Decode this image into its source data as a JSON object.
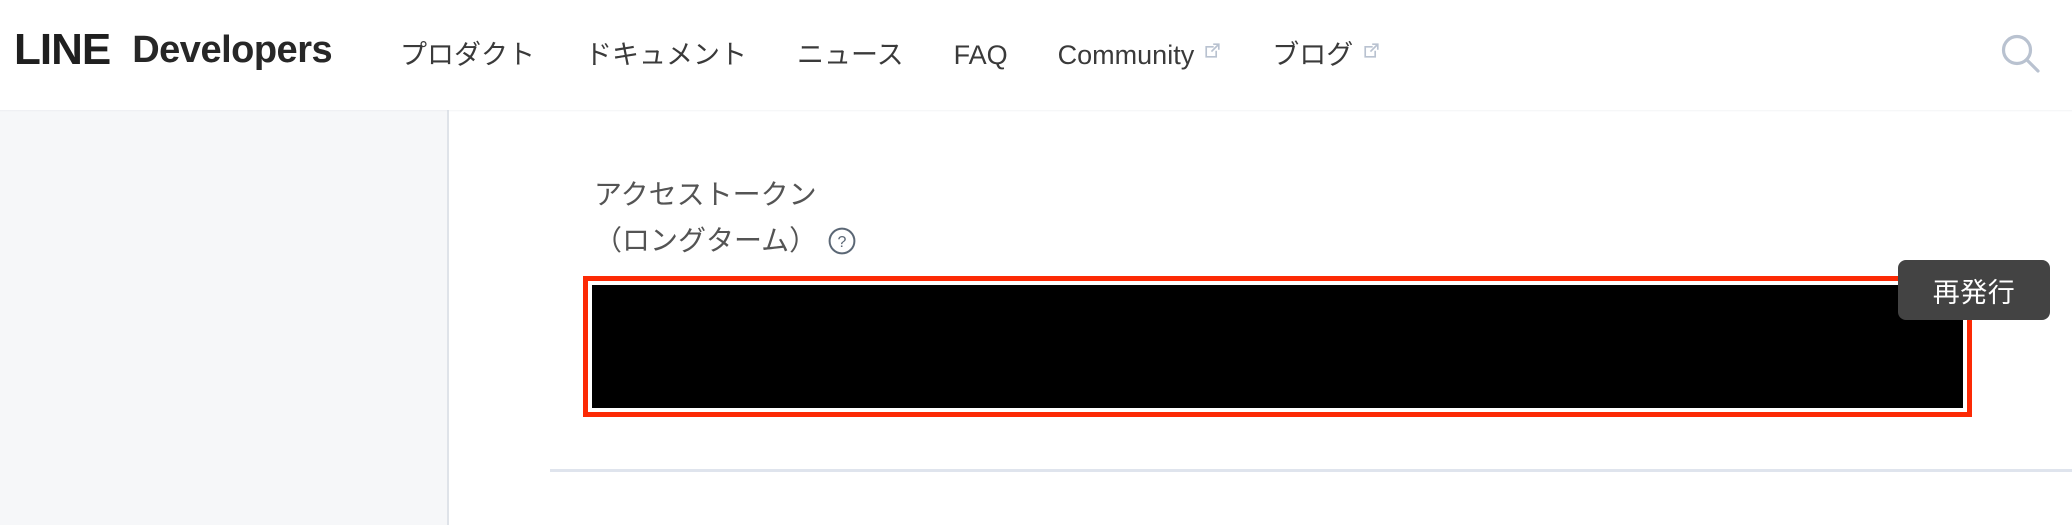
{
  "header": {
    "brand": {
      "line": "LINE",
      "developers": "Developers"
    },
    "nav_items": [
      {
        "label": "プロダクト",
        "external": false,
        "icon": ""
      },
      {
        "label": "ドキュメント",
        "external": false,
        "icon": ""
      },
      {
        "label": "ニュース",
        "external": false,
        "icon": ""
      },
      {
        "label": "FAQ",
        "external": false,
        "icon": ""
      },
      {
        "label": "Community",
        "external": true,
        "icon": "external-link-icon"
      },
      {
        "label": "ブログ",
        "external": true,
        "icon": "external-link-icon"
      }
    ],
    "search_icon": "search-icon"
  },
  "main": {
    "field": {
      "label_line1": "アクセストークン",
      "label_line2": "（ロングターム）",
      "help_icon": "question-mark-circle-icon",
      "value": "",
      "redacted": true
    },
    "reissue_button_label": "再発行"
  },
  "colors": {
    "annotation_red": "#fc2a05",
    "button_dark": "#434343",
    "sidebar_bg": "#f6f7f9",
    "divider": "#dfe4ed",
    "text_primary": "#3a3a3a",
    "label_gray": "#545454",
    "icon_blue_gray": "#b9c2d0"
  }
}
